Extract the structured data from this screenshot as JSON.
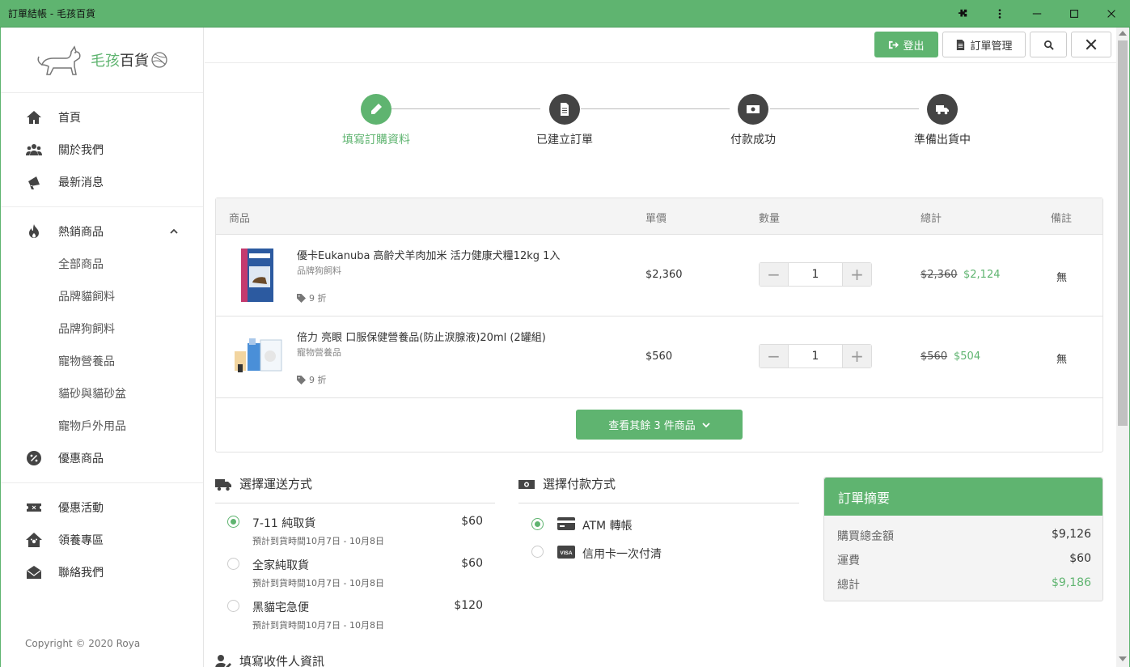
{
  "window": {
    "title": "訂單結帳 - 毛孩百貨"
  },
  "brand": {
    "name_green": "毛孩",
    "name_dark": "百貨"
  },
  "sidebar": {
    "group1": [
      {
        "label": "首頁",
        "icon": "home-icon"
      },
      {
        "label": "關於我們",
        "icon": "users-icon"
      },
      {
        "label": "最新消息",
        "icon": "bullhorn-icon"
      }
    ],
    "hot": {
      "label": "熱銷商品",
      "icon": "fire-icon"
    },
    "hot_sub": [
      "全部商品",
      "品牌貓飼料",
      "品牌狗飼料",
      "寵物營養品",
      "貓砂與貓砂盆",
      "寵物戶外用品"
    ],
    "discount": {
      "label": "優惠商品",
      "icon": "percent-icon"
    },
    "group3": [
      {
        "label": "優惠活動",
        "icon": "ticket-icon"
      },
      {
        "label": "領養專區",
        "icon": "adopt-house-icon"
      },
      {
        "label": "聯絡我們",
        "icon": "envelope-icon"
      }
    ],
    "copyright": "Copyright © 2020 Roya"
  },
  "header": {
    "logout_label": "登出",
    "orders_label": "訂單管理"
  },
  "steps": [
    {
      "label": "填寫訂購資料",
      "icon": "pencil-icon"
    },
    {
      "label": "已建立訂單",
      "icon": "file-icon"
    },
    {
      "label": "付款成功",
      "icon": "money-icon"
    },
    {
      "label": "準備出貨中",
      "icon": "truck-icon"
    }
  ],
  "cart": {
    "headers": {
      "product": "商品",
      "price": "單價",
      "qty": "數量",
      "total": "總計",
      "note": "備註"
    },
    "items": [
      {
        "name": "優卡Eukanuba 高齡犬羊肉加米 活力健康犬糧12kg 1入",
        "category": "品牌狗飼料",
        "tag": "9 折",
        "price": "$2,360",
        "qty": "1",
        "old_total": "$2,360",
        "new_total": "$2,124",
        "note": "無"
      },
      {
        "name": "倍力 亮眼 口服保健營養品(防止淚腺液)20ml (2罐組)",
        "category": "寵物營養品",
        "tag": "9 折",
        "price": "$560",
        "qty": "1",
        "old_total": "$560",
        "new_total": "$504",
        "note": "無"
      }
    ],
    "more_label": "查看其餘 3 件商品"
  },
  "shipping": {
    "title": "選擇運送方式",
    "options": [
      {
        "name": "7-11 純取貨",
        "price": "$60",
        "eta": "預計到貨時間10月7日 - 10月8日",
        "selected": true
      },
      {
        "name": "全家純取貨",
        "price": "$60",
        "eta": "預計到貨時間10月7日 - 10月8日",
        "selected": false
      },
      {
        "name": "黑貓宅急便",
        "price": "$120",
        "eta": "預計到貨時間10月7日 - 10月8日",
        "selected": false
      }
    ]
  },
  "payment": {
    "title": "選擇付款方式",
    "options": [
      {
        "name": "ATM 轉帳",
        "icon": "credit-card-icon",
        "selected": true
      },
      {
        "name": "信用卡一次付清",
        "icon": "visa-icon",
        "selected": false
      }
    ]
  },
  "summary": {
    "title": "訂單摘要",
    "rows": [
      {
        "label": "購買總金額",
        "value": "$9,126"
      },
      {
        "label": "運費",
        "value": "$60"
      },
      {
        "label": "總計",
        "value": "$9,186"
      }
    ]
  },
  "receiver": {
    "title": "填寫收件人資訊"
  },
  "colors": {
    "accent": "#5fb470",
    "dark": "#444444"
  }
}
